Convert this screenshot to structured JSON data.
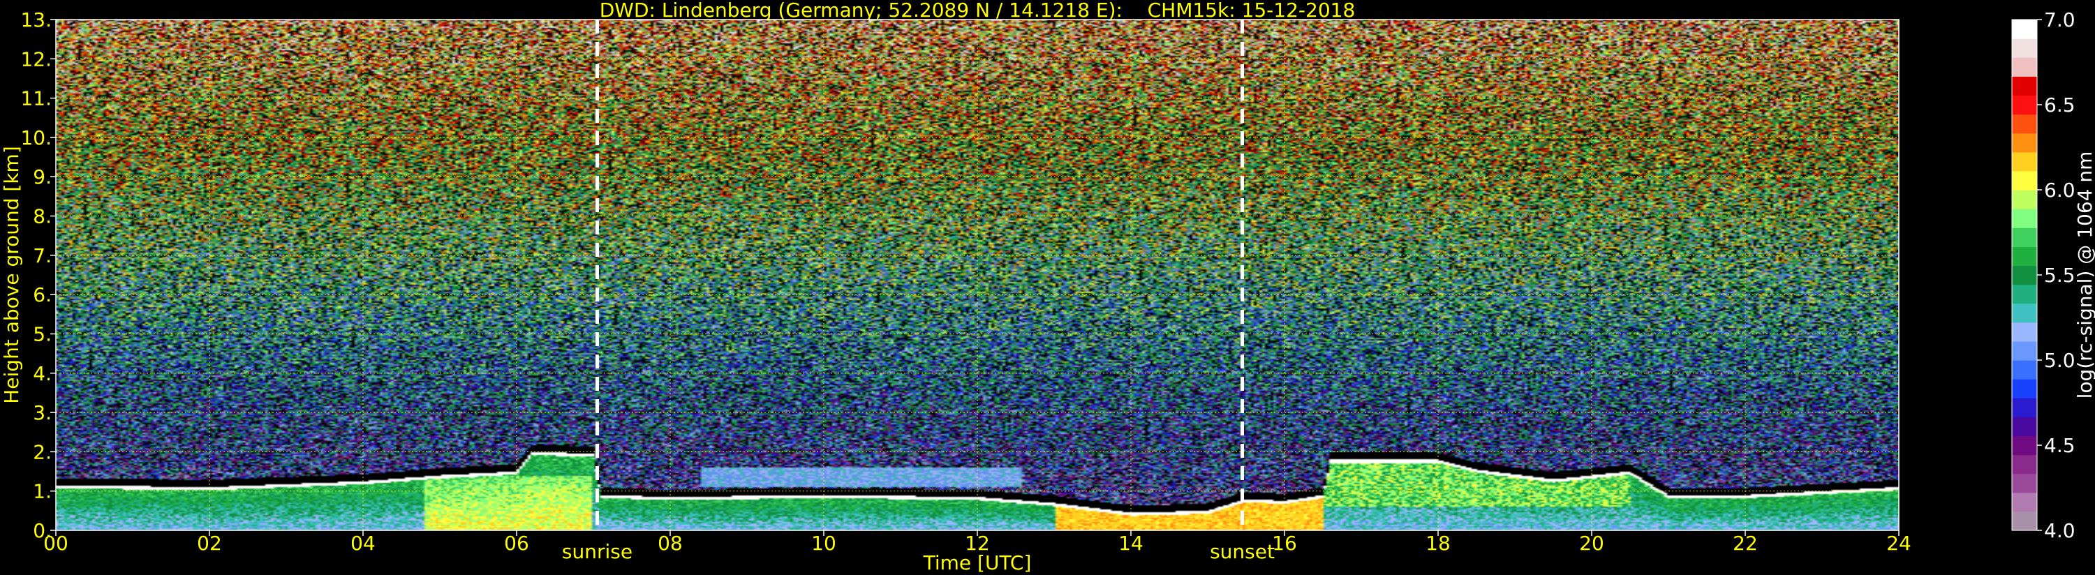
{
  "chart_data": {
    "type": "heatmap",
    "title": "DWD: Lindenberg (Germany; 52.2089 N / 14.1218 E):    CHM15k: 15-12-2018",
    "xlabel": "Time [UTC]",
    "ylabel": "Height above ground [km]",
    "xlim": [
      0,
      24
    ],
    "ylim": [
      0,
      13
    ],
    "x_ticks": [
      0,
      2,
      4,
      6,
      8,
      10,
      12,
      14,
      16,
      18,
      20,
      22,
      24
    ],
    "x_tick_labels": [
      "00",
      "02",
      "04",
      "06",
      "08",
      "10",
      "12",
      "14",
      "16",
      "18",
      "20",
      "22",
      "24"
    ],
    "y_ticks": [
      0,
      1,
      2,
      3,
      4,
      5,
      6,
      7,
      8,
      9,
      10,
      11,
      12,
      13
    ],
    "y_tick_labels": [
      "0.",
      "1.",
      "2.",
      "3.",
      "4.",
      "5.",
      "6.",
      "7.",
      "8.",
      "9.",
      "10.",
      "11.",
      "12.",
      "13."
    ],
    "grid": true,
    "colorbar": {
      "label": "log(rc-signal) @ 1064 nm",
      "range": [
        4.0,
        7.0
      ],
      "ticks": [
        4.0,
        4.5,
        5.0,
        5.5,
        6.0,
        6.5,
        7.0
      ],
      "tick_labels": [
        "4.0",
        "4.5",
        "5.0",
        "5.5",
        "6.0",
        "6.5",
        "7.0"
      ],
      "colors": [
        "#a890a8",
        "#b07cb0",
        "#9a4a9a",
        "#8a2a8a",
        "#700a80",
        "#4a0aa0",
        "#2a1ad0",
        "#1a40ff",
        "#3a70ff",
        "#6a98ff",
        "#9ab8ff",
        "#40c0c0",
        "#20b080",
        "#109040",
        "#20b040",
        "#40d060",
        "#80ff80",
        "#c0ff60",
        "#ffff40",
        "#ffd020",
        "#ff9010",
        "#ff5010",
        "#ff1010",
        "#e00000",
        "#f0c0c0",
        "#f0e0e0",
        "#ffffff"
      ]
    },
    "events": [
      {
        "label": "sunrise",
        "time": 7.05
      },
      {
        "label": "sunset",
        "time": 15.45
      }
    ],
    "colors": {
      "axis_text": "#ffff00",
      "grid": "#ffff00",
      "event_line": "#ffffff",
      "background": "#000000"
    }
  }
}
